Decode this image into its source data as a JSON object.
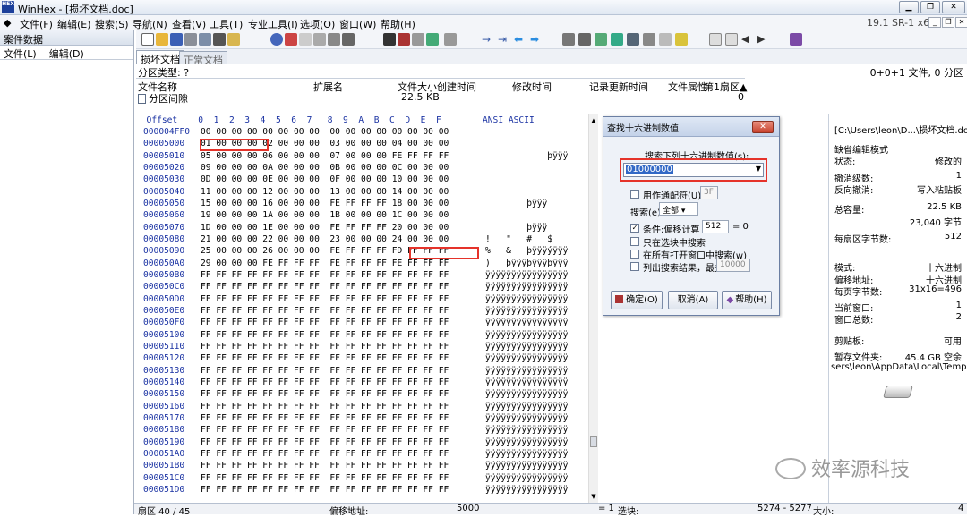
{
  "window": {
    "title": "WinHex - [损坏文档.doc]",
    "app_icon": "HEX"
  },
  "menu": {
    "items": [
      "文件(F)",
      "编辑(E)",
      "搜索(S)",
      "导航(N)",
      "查看(V)",
      "工具(T)",
      "专业工具(I)",
      "选项(O)",
      "窗口(W)",
      "帮助(H)"
    ],
    "version": "19.1 SR-1 x64"
  },
  "left_pane": {
    "title": "案件数据",
    "menu_file": "文件(L)",
    "menu_edit": "编辑(D)"
  },
  "tabs": {
    "active": "损坏文档",
    "inactive": "正常文档"
  },
  "dir": {
    "partition_type": "分区类型: ?",
    "summary": "0+0+1 文件, 0 分区"
  },
  "file_list": {
    "columns": [
      "文件名称",
      "扩展名",
      "文件大小",
      "创建时间",
      "修改时间",
      "记录更新时间",
      "文件属性",
      "第1扇区▲"
    ],
    "row": {
      "name": "分区间隙",
      "size": "22.5 KB",
      "sector": "0"
    }
  },
  "hex": {
    "header": "  Offset    0  1  2  3  4  5  6  7   8  9  A  B  C  D  E  F        ANSI ASCII",
    "rows": [
      {
        "off": "000004FF0",
        "hex": "00 00 00 00 00 00 00 00  00 00 00 00 00 00 00 00",
        "ascii": ""
      },
      {
        "off": "00005000",
        "hex": "01 00 00 00 02 00 00 00  03 00 00 00 04 00 00 00",
        "ascii": ""
      },
      {
        "off": "00005010",
        "hex": "05 00 00 00 06 00 00 00  07 00 00 00 FE FF FF FF",
        "ascii": "            þÿÿÿ"
      },
      {
        "off": "00005020",
        "hex": "09 00 00 00 0A 00 00 00  0B 00 00 00 0C 00 00 00",
        "ascii": ""
      },
      {
        "off": "00005030",
        "hex": "0D 00 00 00 0E 00 00 00  0F 00 00 00 10 00 00 00",
        "ascii": ""
      },
      {
        "off": "00005040",
        "hex": "11 00 00 00 12 00 00 00  13 00 00 00 14 00 00 00",
        "ascii": ""
      },
      {
        "off": "00005050",
        "hex": "15 00 00 00 16 00 00 00  FE FF FF FF 18 00 00 00",
        "ascii": "        þÿÿÿ"
      },
      {
        "off": "00005060",
        "hex": "19 00 00 00 1A 00 00 00  1B 00 00 00 1C 00 00 00",
        "ascii": ""
      },
      {
        "off": "00005070",
        "hex": "1D 00 00 00 1E 00 00 00  FE FF FF FF 20 00 00 00",
        "ascii": "        þÿÿÿ"
      },
      {
        "off": "00005080",
        "hex": "21 00 00 00 22 00 00 00  23 00 00 00 24 00 00 00",
        "ascii": "!   \"   #   $"
      },
      {
        "off": "00005090",
        "hex": "25 00 00 00 26 00 00 00  FE FF FF FF FD FF FF FF",
        "ascii": "%   &   þÿÿÿýÿÿÿ"
      },
      {
        "off": "000050A0",
        "hex": "29 00 00 00 FE FF FF FF  FE FF FF FF FE FF FF FF",
        "ascii": ")   þÿÿÿþÿÿÿþÿÿÿ"
      },
      {
        "off": "000050B0",
        "hex": "FF FF FF FF FF FF FF FF  FF FF FF FF FF FF FF FF",
        "ascii": "ÿÿÿÿÿÿÿÿÿÿÿÿÿÿÿÿ"
      },
      {
        "off": "000050C0",
        "hex": "FF FF FF FF FF FF FF FF  FF FF FF FF FF FF FF FF",
        "ascii": "ÿÿÿÿÿÿÿÿÿÿÿÿÿÿÿÿ"
      },
      {
        "off": "000050D0",
        "hex": "FF FF FF FF FF FF FF FF  FF FF FF FF FF FF FF FF",
        "ascii": "ÿÿÿÿÿÿÿÿÿÿÿÿÿÿÿÿ"
      },
      {
        "off": "000050E0",
        "hex": "FF FF FF FF FF FF FF FF  FF FF FF FF FF FF FF FF",
        "ascii": "ÿÿÿÿÿÿÿÿÿÿÿÿÿÿÿÿ"
      },
      {
        "off": "000050F0",
        "hex": "FF FF FF FF FF FF FF FF  FF FF FF FF FF FF FF FF",
        "ascii": "ÿÿÿÿÿÿÿÿÿÿÿÿÿÿÿÿ"
      },
      {
        "off": "00005100",
        "hex": "FF FF FF FF FF FF FF FF  FF FF FF FF FF FF FF FF",
        "ascii": "ÿÿÿÿÿÿÿÿÿÿÿÿÿÿÿÿ"
      },
      {
        "off": "00005110",
        "hex": "FF FF FF FF FF FF FF FF  FF FF FF FF FF FF FF FF",
        "ascii": "ÿÿÿÿÿÿÿÿÿÿÿÿÿÿÿÿ"
      },
      {
        "off": "00005120",
        "hex": "FF FF FF FF FF FF FF FF  FF FF FF FF FF FF FF FF",
        "ascii": "ÿÿÿÿÿÿÿÿÿÿÿÿÿÿÿÿ"
      },
      {
        "off": "00005130",
        "hex": "FF FF FF FF FF FF FF FF  FF FF FF FF FF FF FF FF",
        "ascii": "ÿÿÿÿÿÿÿÿÿÿÿÿÿÿÿÿ"
      },
      {
        "off": "00005140",
        "hex": "FF FF FF FF FF FF FF FF  FF FF FF FF FF FF FF FF",
        "ascii": "ÿÿÿÿÿÿÿÿÿÿÿÿÿÿÿÿ"
      },
      {
        "off": "00005150",
        "hex": "FF FF FF FF FF FF FF FF  FF FF FF FF FF FF FF FF",
        "ascii": "ÿÿÿÿÿÿÿÿÿÿÿÿÿÿÿÿ"
      },
      {
        "off": "00005160",
        "hex": "FF FF FF FF FF FF FF FF  FF FF FF FF FF FF FF FF",
        "ascii": "ÿÿÿÿÿÿÿÿÿÿÿÿÿÿÿÿ"
      },
      {
        "off": "00005170",
        "hex": "FF FF FF FF FF FF FF FF  FF FF FF FF FF FF FF FF",
        "ascii": "ÿÿÿÿÿÿÿÿÿÿÿÿÿÿÿÿ"
      },
      {
        "off": "00005180",
        "hex": "FF FF FF FF FF FF FF FF  FF FF FF FF FF FF FF FF",
        "ascii": "ÿÿÿÿÿÿÿÿÿÿÿÿÿÿÿÿ"
      },
      {
        "off": "00005190",
        "hex": "FF FF FF FF FF FF FF FF  FF FF FF FF FF FF FF FF",
        "ascii": "ÿÿÿÿÿÿÿÿÿÿÿÿÿÿÿÿ"
      },
      {
        "off": "000051A0",
        "hex": "FF FF FF FF FF FF FF FF  FF FF FF FF FF FF FF FF",
        "ascii": "ÿÿÿÿÿÿÿÿÿÿÿÿÿÿÿÿ"
      },
      {
        "off": "000051B0",
        "hex": "FF FF FF FF FF FF FF FF  FF FF FF FF FF FF FF FF",
        "ascii": "ÿÿÿÿÿÿÿÿÿÿÿÿÿÿÿÿ"
      },
      {
        "off": "000051C0",
        "hex": "FF FF FF FF FF FF FF FF  FF FF FF FF FF FF FF FF",
        "ascii": "ÿÿÿÿÿÿÿÿÿÿÿÿÿÿÿÿ"
      },
      {
        "off": "000051D0",
        "hex": "FF FF FF FF FF FF FF FF  FF FF FF FF FF FF FF FF",
        "ascii": "ÿÿÿÿÿÿÿÿÿÿÿÿÿÿÿÿ"
      }
    ]
  },
  "dialog": {
    "title": "查找十六进制数值",
    "prompt": "搜索下列十六进制数值(s):",
    "value": "01000000",
    "wildcard_label": "用作通配符(U):",
    "wildcard_value": "3F",
    "search_label": "搜索(e):",
    "search_value": "全部",
    "cond_label": "条件:偏移计算",
    "cond_mod": "512",
    "cond_eq": "= 0",
    "only_block": "只在选块中搜索",
    "all_windows": "在所有打开窗口中搜索(w)",
    "list_results": "列出搜索结果，最多",
    "list_max": "10000",
    "ok": "确定(O)",
    "cancel": "取消(A)",
    "help": "帮助(H)"
  },
  "right_pane": {
    "path": "[C:\\Users\\leon\\D...\\损坏文档.doc",
    "mode": "缺省编辑模式",
    "state_label": "状态:",
    "state_value": "修改的",
    "undo_label": "撤消级数:",
    "undo_value": "1",
    "redo_label": "反向撤消:",
    "redo_value": "写入粘贴板",
    "size_label": "总容量:",
    "size_kb": "22.5 KB",
    "size_bytes": "23,040 字节",
    "sector_label": "每扇区字节数:",
    "sector_value": "512",
    "mode_label": "模式:",
    "mode_value": "十六进制",
    "offset_label": "偏移地址:",
    "offset_value": "十六进制",
    "page_label": "每页字节数:",
    "page_value": "31x16=496",
    "curwin_label": "当前窗口:",
    "curwin_value": "1",
    "wincount_label": "窗口总数:",
    "wincount_value": "2",
    "clip_label": "剪贴板:",
    "clip_value": "可用",
    "temp_label": "暂存文件夹:",
    "temp_value": "45.4 GB 空余",
    "temp_path": "sers\\leon\\AppData\\Local\\Temp"
  },
  "status": {
    "sector": "扇区 40 / 45",
    "offset_label": "偏移地址:",
    "offset_value": "5000",
    "eq": "= 1",
    "sel_label": "选块:",
    "sel_value": "5274 - 5277",
    "size_label": "大小:",
    "size_value": "4"
  },
  "watermark": "效率源科技"
}
